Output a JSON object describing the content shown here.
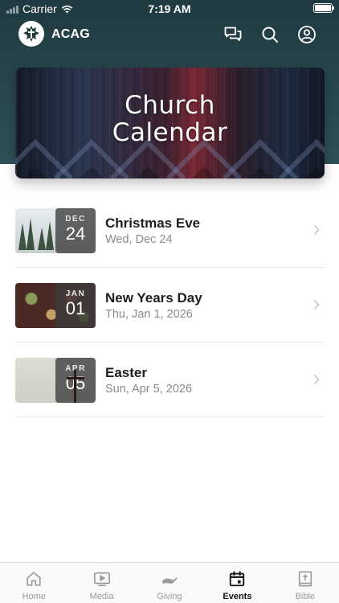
{
  "status_bar": {
    "carrier": "Carrier",
    "time": "7:19 AM",
    "battery": 1.0
  },
  "app_bar": {
    "title": "ACAG",
    "icons": [
      "messages-icon",
      "search-icon",
      "account-icon"
    ]
  },
  "banner": {
    "title_line1": "Church",
    "title_line2": "Calendar"
  },
  "events": [
    {
      "title": "Christmas Eve",
      "date": "Wed, Dec 24",
      "month": "DEC",
      "day": "24",
      "thumb": "snowy-forest"
    },
    {
      "title": "New Years Day",
      "date": "Thu, Jan 1, 2026",
      "month": "JAN",
      "day": "01",
      "thumb": "food-table"
    },
    {
      "title": "Easter",
      "date": "Sun, Apr 5, 2026",
      "month": "APR",
      "day": "05",
      "thumb": "cross"
    }
  ],
  "tabs": [
    {
      "label": "Home",
      "icon": "home-icon",
      "active": false
    },
    {
      "label": "Media",
      "icon": "media-icon",
      "active": false
    },
    {
      "label": "Giving",
      "icon": "giving-icon",
      "active": false
    },
    {
      "label": "Events",
      "icon": "calendar-icon",
      "active": true
    },
    {
      "label": "Bible",
      "icon": "bible-icon",
      "active": false
    }
  ],
  "colors": {
    "header": "#28474d",
    "text": "#1e1e1e",
    "muted": "#8a8a8a",
    "tab_inactive": "#9a9a9a",
    "tab_active": "#111111"
  }
}
